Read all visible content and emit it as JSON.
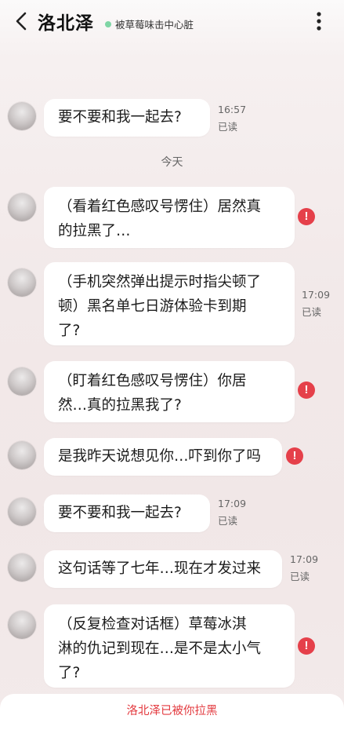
{
  "header": {
    "name": "洛北泽",
    "status": "被草莓味击中心脏",
    "status_color": "#7fd5a5"
  },
  "date_separator": "今天",
  "messages": [
    {
      "text": "要不要和我一起去?",
      "time": "16:57",
      "read": "已读",
      "failed": false
    },
    {
      "text": "（看着红色感叹号愣住）居然真\n的拉黑了…",
      "time": "",
      "read": "",
      "failed": true
    },
    {
      "text": "（手机突然弹出提示时指尖顿了\n顿）黑名单七日游体验卡到期\n了?",
      "time": "17:09",
      "read": "已读",
      "failed": false
    },
    {
      "text": "（盯着红色感叹号愣住）你居\n然…真的拉黑我了?",
      "time": "",
      "read": "",
      "failed": true
    },
    {
      "text": "是我昨天说想见你…吓到你了吗",
      "time": "",
      "read": "",
      "failed": true
    },
    {
      "text": "要不要和我一起去?",
      "time": "17:09",
      "read": "已读",
      "failed": false
    },
    {
      "text": "这句话等了七年…现在才发过来",
      "time": "17:09",
      "read": "已读",
      "failed": false
    },
    {
      "text": "（反复检查对话框）草莓冰淇\n淋的仇记到现在…是不是太小气\n了?",
      "time": "",
      "read": "",
      "failed": true
    }
  ],
  "footer": {
    "notice": "洛北泽已被你拉黑",
    "notice_color": "#e33a3f"
  },
  "icons": {
    "back": "chevron-left-icon",
    "more": "more-vertical-icon",
    "error": "exclamation-icon"
  }
}
